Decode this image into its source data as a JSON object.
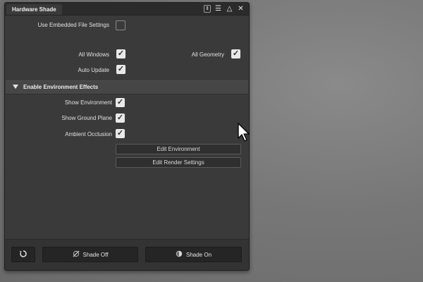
{
  "window": {
    "title": "Hardware Shade",
    "icons": [
      "sort-updown-icon",
      "menu-icon",
      "collapse-triangle-icon",
      "close-icon"
    ]
  },
  "settings": {
    "use_embedded_label": "Use Embedded File Settings",
    "use_embedded_checked": false,
    "all_windows_label": "All Windows",
    "all_windows_checked": true,
    "all_geometry_label": "All Geometry",
    "all_geometry_checked": true,
    "auto_update_label": "Auto Update",
    "auto_update_checked": true
  },
  "environment": {
    "section_title": "Enable Environment Effects",
    "show_environment_label": "Show Environment",
    "show_environment_checked": true,
    "show_ground_plane_label": "Show Ground Plane",
    "show_ground_plane_checked": true,
    "ambient_occlusion_label": "Ambient Occlusion",
    "ambient_occlusion_checked": true,
    "edit_environment_label": "Edit Environment",
    "edit_render_settings_label": "Edit Render Settings"
  },
  "footer": {
    "reset_icon": "reset-icon",
    "shade_off_label": "Shade Off",
    "shade_on_label": "Shade On"
  },
  "colors": {
    "panel_bg": "#3a3a3a",
    "checkbox_checked_bg": "#e9e9e9",
    "section_bg": "#464646"
  }
}
